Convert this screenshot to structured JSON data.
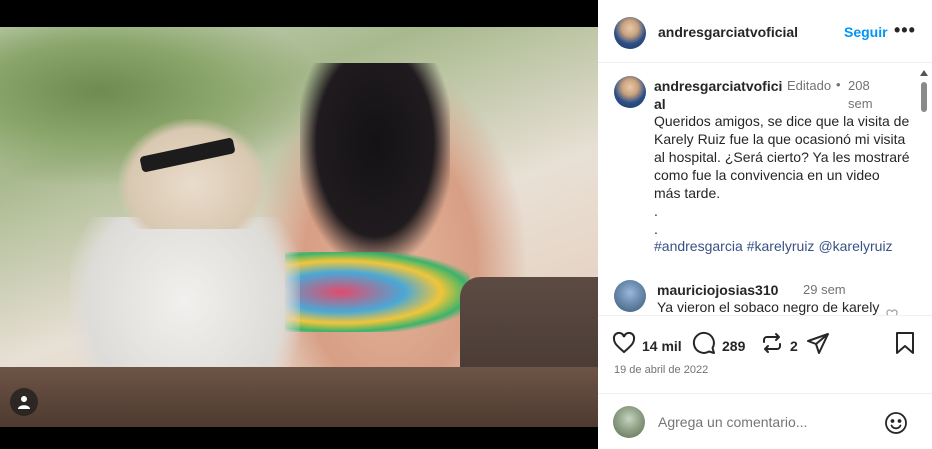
{
  "post": {
    "username": "andresgarciatvoficial",
    "follow_label": "Seguir",
    "more_label": "•••"
  },
  "caption": {
    "username": "andresgarciatvoficial",
    "edited": "Editado",
    "separator": "•",
    "time": "208 sem",
    "text": "Queridos amigos, se dice que la visita de Karely Ruiz fue la que ocasionó mi visita al hospital. ¿Será cierto? Ya les mostraré como fue la convivencia en un video más tarde.",
    "dots": ".\n.",
    "hashtags": [
      "#andresgarcia",
      "#karelyruiz",
      "@karelyruiz"
    ]
  },
  "comment": {
    "username": "mauriciojosias310",
    "time": "29 sem",
    "text": "Ya vieron el sobaco negro de karely"
  },
  "actions": {
    "likes": "14 mil",
    "comments": "289",
    "reposts": "2"
  },
  "date": "19 de abril de 2022",
  "add_comment": {
    "placeholder": "Agrega un comentario..."
  },
  "icons": {
    "user_tag": "person-icon",
    "like": "heart-icon",
    "comment": "comment-icon",
    "repost": "repost-icon",
    "share": "send-icon",
    "save": "bookmark-icon",
    "emoji": "smiley-icon"
  }
}
